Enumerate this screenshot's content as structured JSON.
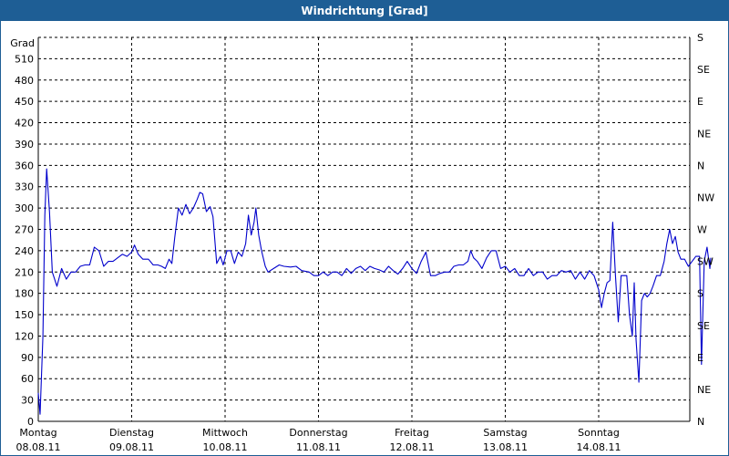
{
  "window": {
    "title": "Windrichtung [Grad]"
  },
  "colors": {
    "titlebar": "#1e5e95",
    "series": "#0000cc",
    "grid": "#000000",
    "background": "#ffffff"
  },
  "chart_data": {
    "type": "line",
    "title": "Windrichtung [Grad]",
    "ylabel": "Grad",
    "ylim": [
      0,
      540
    ],
    "y_ticks": [
      0,
      30,
      60,
      90,
      120,
      150,
      180,
      210,
      240,
      270,
      300,
      330,
      360,
      390,
      420,
      450,
      480,
      510
    ],
    "right_ticks": [
      {
        "value": 0,
        "label": "N"
      },
      {
        "value": 45,
        "label": "NE"
      },
      {
        "value": 90,
        "label": "E"
      },
      {
        "value": 135,
        "label": "SE"
      },
      {
        "value": 180,
        "label": "S"
      },
      {
        "value": 225,
        "label": "SW"
      },
      {
        "value": 270,
        "label": "W"
      },
      {
        "value": 315,
        "label": "NW"
      },
      {
        "value": 360,
        "label": "N"
      },
      {
        "value": 405,
        "label": "NE"
      },
      {
        "value": 450,
        "label": "E"
      },
      {
        "value": 495,
        "label": "SE"
      },
      {
        "value": 540,
        "label": "S"
      }
    ],
    "grid": true,
    "xlim": [
      0,
      7
    ],
    "x_ticks": [
      {
        "day": "Montag",
        "date": "08.08.11"
      },
      {
        "day": "Dienstag",
        "date": "09.08.11"
      },
      {
        "day": "Mittwoch",
        "date": "10.08.11"
      },
      {
        "day": "Donnerstag",
        "date": "11.08.11"
      },
      {
        "day": "Freitag",
        "date": "12.08.11"
      },
      {
        "day": "Samstag",
        "date": "13.08.11"
      },
      {
        "day": "Sonntag",
        "date": "14.08.11"
      }
    ],
    "series": [
      {
        "points": [
          [
            0.0,
            40
          ],
          [
            0.02,
            10
          ],
          [
            0.05,
            120
          ],
          [
            0.07,
            290
          ],
          [
            0.09,
            355
          ],
          [
            0.12,
            295
          ],
          [
            0.15,
            210
          ],
          [
            0.2,
            190
          ],
          [
            0.25,
            215
          ],
          [
            0.3,
            200
          ],
          [
            0.35,
            210
          ],
          [
            0.4,
            210
          ],
          [
            0.45,
            218
          ],
          [
            0.5,
            220
          ],
          [
            0.55,
            220
          ],
          [
            0.6,
            245
          ],
          [
            0.65,
            240
          ],
          [
            0.7,
            218
          ],
          [
            0.75,
            225
          ],
          [
            0.8,
            225
          ],
          [
            0.85,
            230
          ],
          [
            0.9,
            235
          ],
          [
            0.95,
            232
          ],
          [
            1.0,
            238
          ],
          [
            1.03,
            248
          ],
          [
            1.07,
            235
          ],
          [
            1.12,
            228
          ],
          [
            1.18,
            228
          ],
          [
            1.23,
            220
          ],
          [
            1.28,
            220
          ],
          [
            1.32,
            218
          ],
          [
            1.36,
            215
          ],
          [
            1.4,
            228
          ],
          [
            1.43,
            222
          ],
          [
            1.46,
            258
          ],
          [
            1.5,
            300
          ],
          [
            1.54,
            290
          ],
          [
            1.58,
            305
          ],
          [
            1.62,
            292
          ],
          [
            1.66,
            300
          ],
          [
            1.7,
            312
          ],
          [
            1.73,
            322
          ],
          [
            1.76,
            320
          ],
          [
            1.8,
            295
          ],
          [
            1.84,
            302
          ],
          [
            1.87,
            288
          ],
          [
            1.91,
            222
          ],
          [
            1.95,
            232
          ],
          [
            1.98,
            220
          ],
          [
            2.02,
            240
          ],
          [
            2.06,
            240
          ],
          [
            2.1,
            222
          ],
          [
            2.14,
            238
          ],
          [
            2.18,
            232
          ],
          [
            2.22,
            250
          ],
          [
            2.25,
            290
          ],
          [
            2.28,
            262
          ],
          [
            2.31,
            280
          ],
          [
            2.33,
            300
          ],
          [
            2.36,
            262
          ],
          [
            2.39,
            240
          ],
          [
            2.43,
            218
          ],
          [
            2.46,
            210
          ],
          [
            2.52,
            215
          ],
          [
            2.58,
            220
          ],
          [
            2.63,
            218
          ],
          [
            2.7,
            217
          ],
          [
            2.76,
            218
          ],
          [
            2.82,
            212
          ],
          [
            2.9,
            210
          ],
          [
            2.95,
            205
          ],
          [
            3.0,
            205
          ],
          [
            3.05,
            210
          ],
          [
            3.1,
            205
          ],
          [
            3.15,
            210
          ],
          [
            3.2,
            210
          ],
          [
            3.25,
            205
          ],
          [
            3.3,
            215
          ],
          [
            3.35,
            208
          ],
          [
            3.4,
            215
          ],
          [
            3.45,
            218
          ],
          [
            3.5,
            212
          ],
          [
            3.55,
            218
          ],
          [
            3.6,
            215
          ],
          [
            3.65,
            213
          ],
          [
            3.7,
            210
          ],
          [
            3.75,
            218
          ],
          [
            3.8,
            212
          ],
          [
            3.85,
            207
          ],
          [
            3.9,
            215
          ],
          [
            3.95,
            225
          ],
          [
            4.0,
            215
          ],
          [
            4.05,
            208
          ],
          [
            4.1,
            225
          ],
          [
            4.15,
            238
          ],
          [
            4.2,
            205
          ],
          [
            4.25,
            205
          ],
          [
            4.3,
            208
          ],
          [
            4.35,
            210
          ],
          [
            4.4,
            210
          ],
          [
            4.45,
            218
          ],
          [
            4.5,
            220
          ],
          [
            4.55,
            220
          ],
          [
            4.6,
            225
          ],
          [
            4.63,
            240
          ],
          [
            4.66,
            230
          ],
          [
            4.7,
            225
          ],
          [
            4.75,
            215
          ],
          [
            4.8,
            230
          ],
          [
            4.85,
            240
          ],
          [
            4.9,
            240
          ],
          [
            4.95,
            215
          ],
          [
            5.0,
            218
          ],
          [
            5.05,
            210
          ],
          [
            5.1,
            215
          ],
          [
            5.15,
            205
          ],
          [
            5.2,
            205
          ],
          [
            5.25,
            215
          ],
          [
            5.3,
            205
          ],
          [
            5.35,
            210
          ],
          [
            5.4,
            210
          ],
          [
            5.45,
            200
          ],
          [
            5.5,
            205
          ],
          [
            5.55,
            205
          ],
          [
            5.6,
            212
          ],
          [
            5.65,
            210
          ],
          [
            5.7,
            212
          ],
          [
            5.75,
            200
          ],
          [
            5.8,
            210
          ],
          [
            5.85,
            200
          ],
          [
            5.9,
            212
          ],
          [
            5.95,
            205
          ],
          [
            6.0,
            185
          ],
          [
            6.03,
            160
          ],
          [
            6.06,
            180
          ],
          [
            6.09,
            195
          ],
          [
            6.12,
            198
          ],
          [
            6.15,
            280
          ],
          [
            6.18,
            205
          ],
          [
            6.21,
            140
          ],
          [
            6.24,
            205
          ],
          [
            6.27,
            205
          ],
          [
            6.3,
            205
          ],
          [
            6.33,
            150
          ],
          [
            6.36,
            120
          ],
          [
            6.38,
            195
          ],
          [
            6.4,
            115
          ],
          [
            6.43,
            55
          ],
          [
            6.46,
            170
          ],
          [
            6.49,
            180
          ],
          [
            6.52,
            175
          ],
          [
            6.55,
            180
          ],
          [
            6.58,
            190
          ],
          [
            6.62,
            205
          ],
          [
            6.66,
            205
          ],
          [
            6.7,
            225
          ],
          [
            6.73,
            250
          ],
          [
            6.76,
            270
          ],
          [
            6.79,
            250
          ],
          [
            6.82,
            260
          ],
          [
            6.85,
            238
          ],
          [
            6.88,
            228
          ],
          [
            6.92,
            228
          ],
          [
            6.96,
            218
          ],
          [
            7.0,
            225
          ],
          [
            7.04,
            232
          ],
          [
            7.08,
            232
          ],
          [
            7.1,
            80
          ],
          [
            7.13,
            225
          ],
          [
            7.16,
            245
          ],
          [
            7.19,
            215
          ],
          [
            7.2,
            230
          ]
        ]
      }
    ]
  }
}
